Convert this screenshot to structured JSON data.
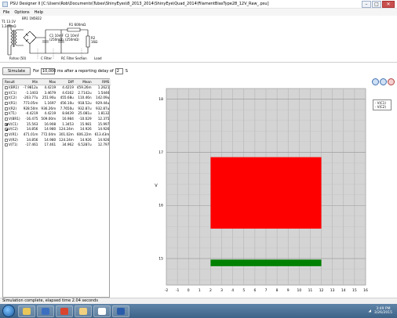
{
  "window": {
    "title": "PSU Designer II  [C:\\Users\\Rob\\Documents\\Tubes\\ShinyEyes\\8_2013_2014\\ShinyEye\\Quad_2014\\FilamentBiasType28_12V_Raw_.psu]"
  },
  "menu": [
    "File",
    "Options",
    "Help"
  ],
  "schematic": {
    "transformer": "T1 13.1V",
    "rectifier": "BR1 1N5822",
    "c1": "C1 10mF",
    "c1_esr": "(250mΩ)",
    "c2": "C2 10mF",
    "c2_esr": "(250mΩ)",
    "r1": "R1 600mΩ",
    "r2": "R2",
    "r2_val": "16Ω",
    "label_left": "1.249mΩ",
    "sections": [
      "Rshas (50)",
      "C Filter",
      "RC Filter Section",
      "Load"
    ]
  },
  "sim": {
    "button": "Simulate",
    "for_label": "For",
    "duration": "10,000",
    "after_label": "ms  after a reporting delay of",
    "delay": "2",
    "delay_unit": "S"
  },
  "results": {
    "headers": [
      "Result",
      "Min",
      "Max",
      "Diff",
      "Mean",
      "RMS"
    ],
    "rows": [
      {
        "name": "I(BR1)",
        "checked": false,
        "min": "-7.9812u",
        "max": "4.4219",
        "diff": "4.4219",
        "mean": "459.26m",
        "rms": "1.2621"
      },
      {
        "name": "I(C1)",
        "checked": false,
        "min": "-1.1403",
        "max": "3.4679",
        "diff": "4.6162",
        "mean": "2.7142u",
        "rms": "1.5446"
      },
      {
        "name": "I(C2)",
        "checked": false,
        "min": "-203.77u",
        "max": "251.90u",
        "diff": "455.68u",
        "mean": "110.46n",
        "rms": "142.09u"
      },
      {
        "name": "I(R1)",
        "checked": false,
        "min": "773.05m",
        "max": "1.1697",
        "diff": "456.10u",
        "mean": "918.52u",
        "rms": "929.44u"
      },
      {
        "name": "I(R2)",
        "checked": false,
        "min": "928.50m",
        "max": "936.26m",
        "diff": "7.7650u",
        "mean": "932.87u",
        "rms": "932.87u"
      },
      {
        "name": "I(T1)",
        "checked": false,
        "min": "-4.4219",
        "max": "4.4219",
        "diff": "8.8439",
        "mean": "25.081u",
        "rms": "1.8132"
      },
      {
        "name": "V(BR1)",
        "checked": false,
        "min": "-16.475",
        "max": "509.00m",
        "diff": "16.984",
        "mean": "-10.029",
        "rms": "12.375"
      },
      {
        "name": "V(C1)",
        "checked": true,
        "min": "15.563",
        "max": "16.908",
        "diff": "1.3453",
        "mean": "15.981",
        "rms": "15.997"
      },
      {
        "name": "V(C2)",
        "checked": true,
        "min": "14.856",
        "max": "14.980",
        "diff": "124.24m",
        "mean": "14.926",
        "rms": "14.926"
      },
      {
        "name": "V(R1)",
        "checked": false,
        "min": "471.01m",
        "max": "772.04m",
        "diff": "301.02m",
        "mean": "606.22m",
        "rms": "613.43m"
      },
      {
        "name": "V(R2)",
        "checked": false,
        "min": "14.856",
        "max": "14.980",
        "diff": "124.24m",
        "mean": "14.926",
        "rms": "14.926"
      },
      {
        "name": "V(T1)",
        "checked": false,
        "min": "-17.461",
        "max": "17.461",
        "diff": "34.962",
        "mean": "6.5287u",
        "rms": "12.797"
      }
    ]
  },
  "chart_data": {
    "type": "area",
    "xlabel": "",
    "ylabel": "V",
    "xlim": [
      -2,
      16
    ],
    "ylim": [
      14.5,
      18.2
    ],
    "xticks": [
      -2,
      -1,
      0,
      1,
      2,
      3,
      4,
      5,
      6,
      7,
      8,
      9,
      10,
      11,
      12,
      13,
      14,
      15,
      16
    ],
    "yticks": [
      15,
      16,
      17,
      18
    ],
    "grid": true,
    "series": [
      {
        "name": "V(C1)",
        "color": "#ff0000",
        "x": [
          2,
          12
        ],
        "y_min": 15.563,
        "y_max": 16.908
      },
      {
        "name": "V(C2)",
        "color": "#008000",
        "x": [
          2,
          12
        ],
        "y_min": 14.856,
        "y_max": 14.98
      }
    ],
    "legend": [
      "- V(C1)",
      "- V(C2)"
    ],
    "legend_position": "right"
  },
  "status": {
    "text": "Simulation complete, elapsed time 2.04 seconds"
  },
  "taskbar": {
    "time": "3:49 PM",
    "date": "3/26/2015",
    "apps": [
      {
        "name": "explorer",
        "color": "#e8c65a"
      },
      {
        "name": "media",
        "color": "#3b6fc0"
      },
      {
        "name": "chrome",
        "color": "#d8442e"
      },
      {
        "name": "folder",
        "color": "#f0d080"
      },
      {
        "name": "psu",
        "color": "#ffffff"
      },
      {
        "name": "word",
        "color": "#2a5cab"
      }
    ]
  }
}
